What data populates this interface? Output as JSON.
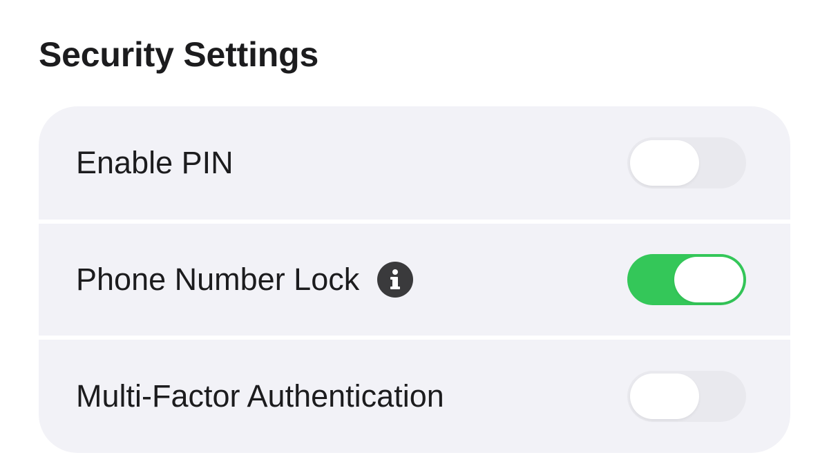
{
  "header": {
    "title": "Security Settings"
  },
  "settings": [
    {
      "label": "Enable PIN",
      "enabled": false,
      "has_info": false
    },
    {
      "label": "Phone Number Lock",
      "enabled": true,
      "has_info": true,
      "info_icon": "info-icon"
    },
    {
      "label": "Multi-Factor Authentication",
      "enabled": false,
      "has_info": false
    }
  ],
  "colors": {
    "toggle_on": "#34c759",
    "toggle_off": "#e9e9ee",
    "row_background": "#f2f2f7",
    "info_icon": "#3a3a3c"
  }
}
